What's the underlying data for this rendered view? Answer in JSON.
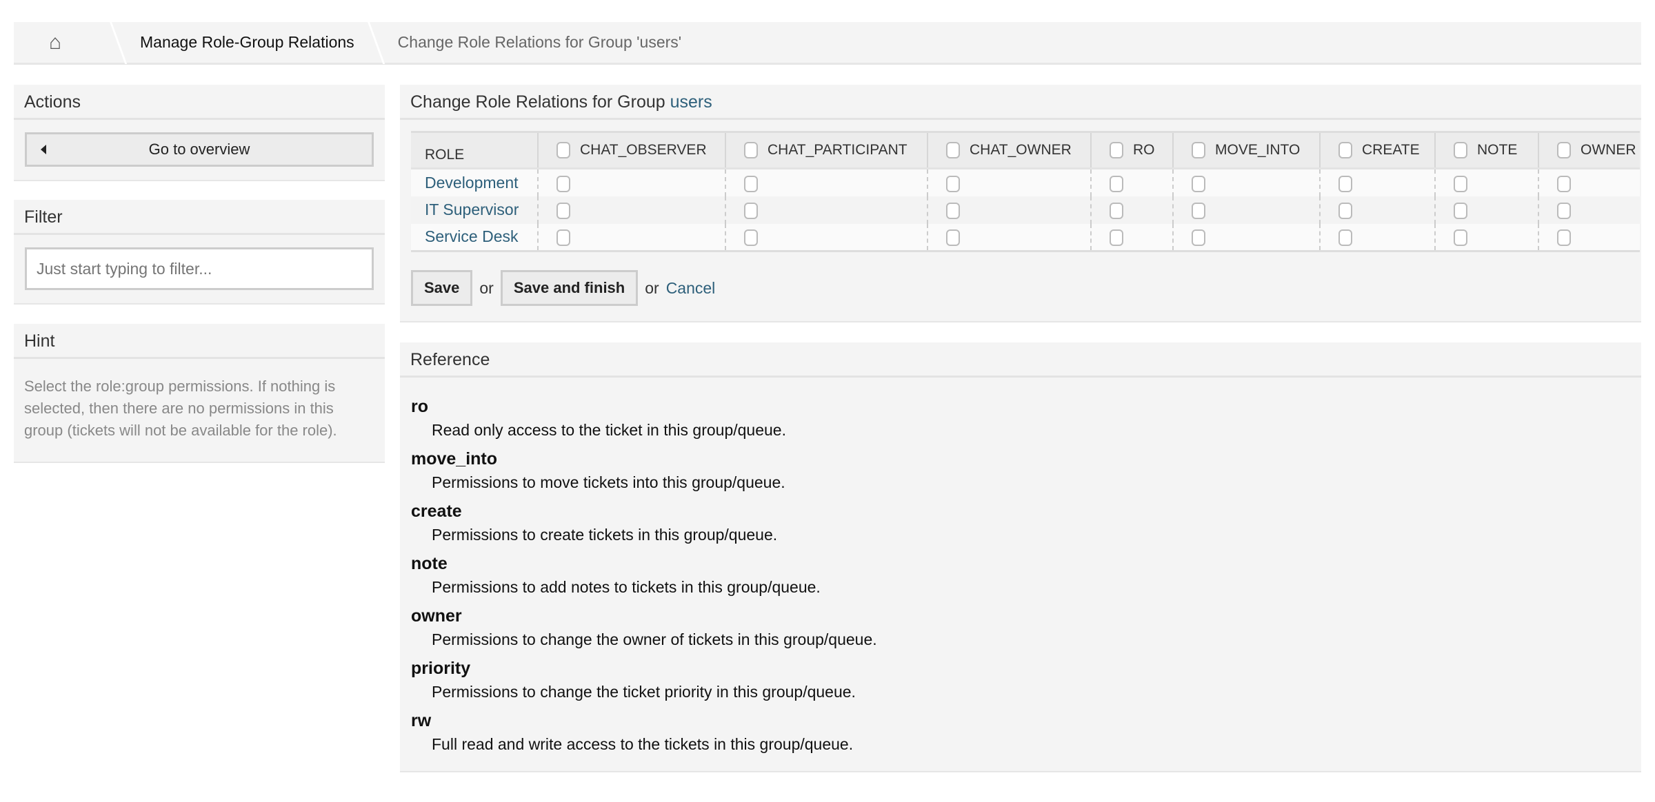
{
  "breadcrumb": {
    "home_icon": "home-icon",
    "items": [
      "Manage Role-Group Relations",
      "Change Role Relations for Group 'users'"
    ]
  },
  "sidebar": {
    "actions": {
      "title": "Actions",
      "overview_button": "Go to overview"
    },
    "filter": {
      "title": "Filter",
      "placeholder": "Just start typing to filter..."
    },
    "hint": {
      "title": "Hint",
      "text": "Select the role:group permissions. If nothing is selected, then there are no permissions in this group (tickets will not be available for the role)."
    }
  },
  "main": {
    "title_prefix": "Change Role Relations for Group ",
    "group_name": "users",
    "table": {
      "role_header": "ROLE",
      "columns": [
        "CHAT_OBSERVER",
        "CHAT_PARTICIPANT",
        "CHAT_OWNER",
        "RO",
        "MOVE_INTO",
        "CREATE",
        "NOTE",
        "OWNER"
      ],
      "rows": [
        {
          "role": "Development",
          "checked": [
            false,
            false,
            false,
            false,
            false,
            false,
            false,
            false
          ]
        },
        {
          "role": "IT Supervisor",
          "checked": [
            false,
            false,
            false,
            false,
            false,
            false,
            false,
            false
          ]
        },
        {
          "role": "Service Desk",
          "checked": [
            false,
            false,
            false,
            false,
            false,
            false,
            false,
            false
          ]
        }
      ]
    },
    "save": "Save",
    "or1": "or",
    "save_finish": "Save and finish",
    "or2": "or",
    "cancel": "Cancel"
  },
  "reference": {
    "title": "Reference",
    "items": [
      {
        "term": "ro",
        "desc": "Read only access to the ticket in this group/queue."
      },
      {
        "term": "move_into",
        "desc": "Permissions to move tickets into this group/queue."
      },
      {
        "term": "create",
        "desc": "Permissions to create tickets in this group/queue."
      },
      {
        "term": "note",
        "desc": "Permissions to add notes to tickets in this group/queue."
      },
      {
        "term": "owner",
        "desc": "Permissions to change the owner of tickets in this group/queue."
      },
      {
        "term": "priority",
        "desc": "Permissions to change the ticket priority in this group/queue."
      },
      {
        "term": "rw",
        "desc": "Full read and write access to the tickets in this group/queue."
      }
    ]
  }
}
